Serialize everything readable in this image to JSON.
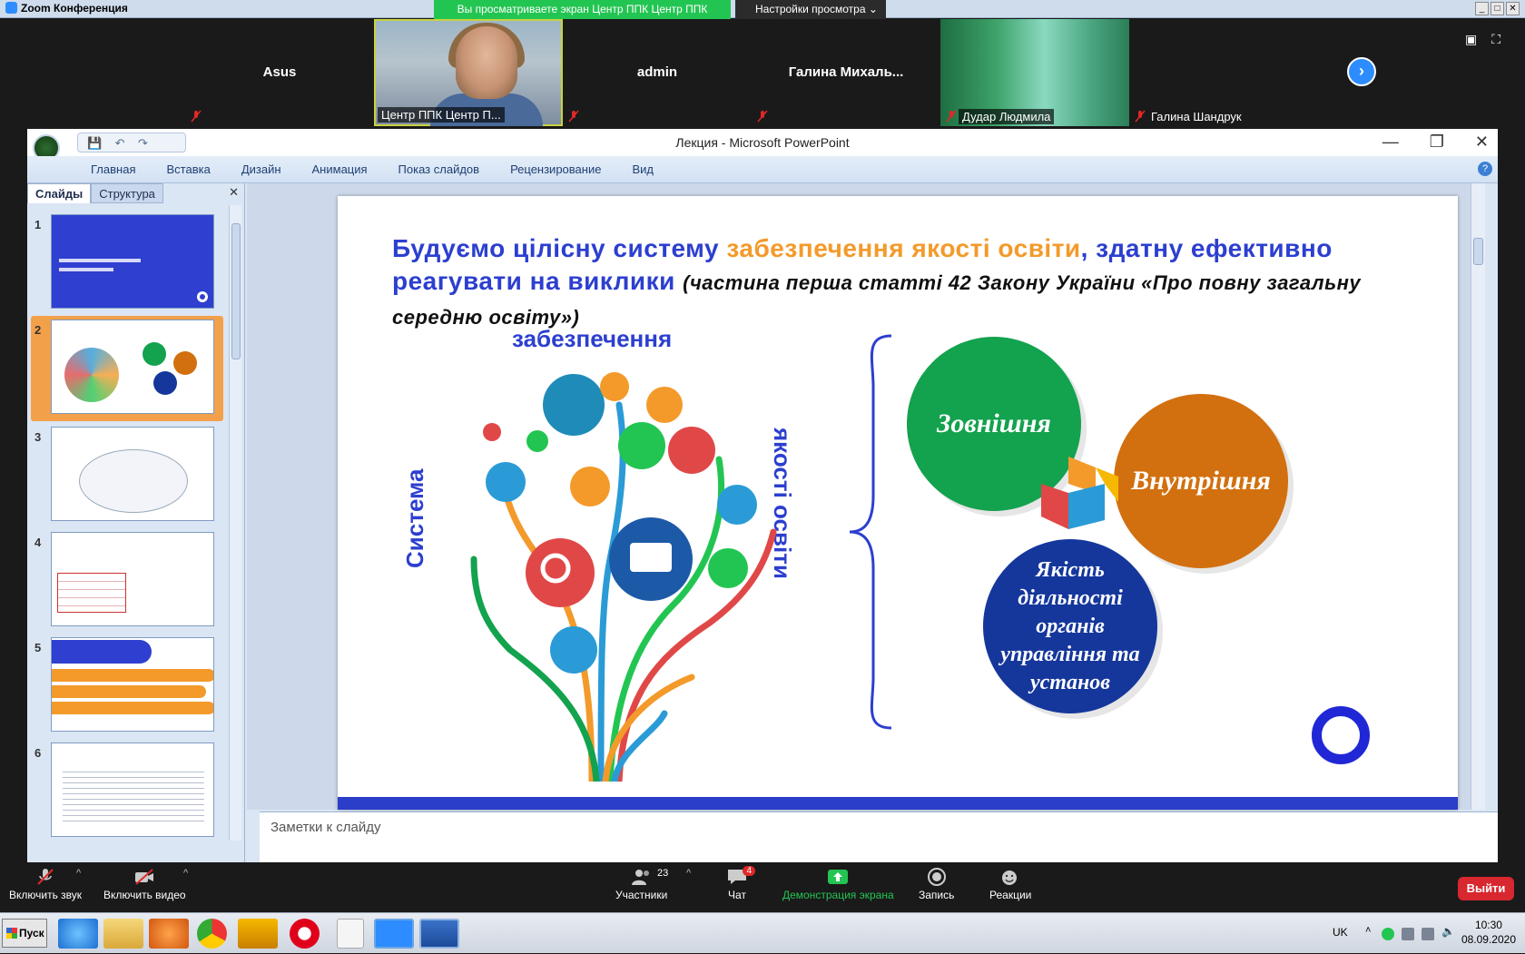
{
  "zoom": {
    "title": "Zoom Конференция",
    "share_banner": "Вы просматриваете экран Центр ППК Центр ППК",
    "view_options": "Настройки просмотра",
    "participants": [
      {
        "name": "Asus",
        "type": "name"
      },
      {
        "name": "Центр ППК Центр П...",
        "type": "video"
      },
      {
        "name": "admin",
        "type": "name"
      },
      {
        "name": "Галина  Михаль...",
        "type": "name"
      },
      {
        "name": "Дудар Людмила",
        "type": "video"
      },
      {
        "name": "Галина Шандрук",
        "type": "label"
      }
    ],
    "toolbar": {
      "unmute": "Включить звук",
      "start_video": "Включить видео",
      "participants": "Участники",
      "participants_count": "23",
      "chat": "Чат",
      "chat_badge": "4",
      "share": "Демонстрация экрана",
      "record": "Запись",
      "reactions": "Реакции",
      "leave": "Выйти"
    }
  },
  "ppt": {
    "title": "Лекция - Microsoft PowerPoint",
    "tabs": [
      "Главная",
      "Вставка",
      "Дизайн",
      "Анимация",
      "Показ слайдов",
      "Рецензирование",
      "Вид"
    ],
    "panel_tabs": {
      "slides": "Слайды",
      "outline": "Структура"
    },
    "slide_numbers": [
      "1",
      "2",
      "3",
      "4",
      "5",
      "6"
    ],
    "notes_placeholder": "Заметки к слайду",
    "slide": {
      "headline_part1": "Будуємо цілісну систему ",
      "headline_orange": "забезпечення якості освіти",
      "headline_part2": ", здатну ефективно реагувати на виклики ",
      "headline_italic": "(частина перша статті 42 Закону України «Про повну загальну середню освіту»)",
      "tree_top": "забезпечення",
      "tree_left": "Система",
      "tree_right": "якості освіти",
      "circle_green": "Зовнішня",
      "circle_orange": "Внутрішня",
      "circle_blue": "Якість діяльності органів управління та установ"
    }
  },
  "taskbar": {
    "start": "Пуск",
    "lang": "UK",
    "time": "10:30",
    "date": "08.09.2020"
  }
}
